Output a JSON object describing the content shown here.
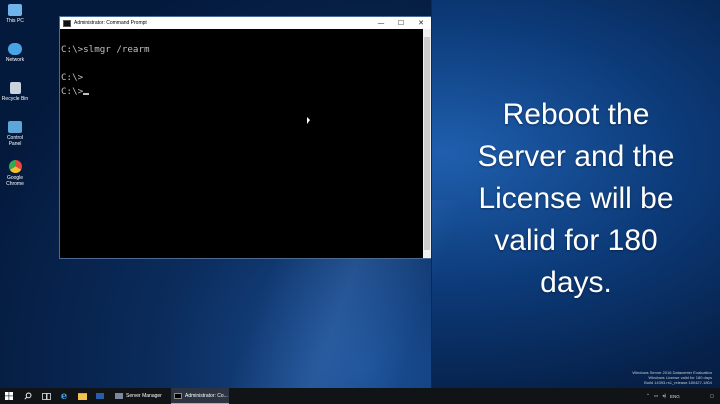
{
  "desktop": {
    "icons": [
      {
        "label": "This PC",
        "icon": "computer-icon",
        "color": "#6fb3ea"
      },
      {
        "label": "Network",
        "icon": "network-icon",
        "color": "#4aa3e6"
      },
      {
        "label": "Recycle Bin",
        "icon": "recycle-bin-icon",
        "color": "#c9d3dc"
      },
      {
        "label": "Control Panel",
        "icon": "control-panel-icon",
        "color": "#5fa6d8"
      },
      {
        "label": "Google Chrome",
        "icon": "chrome-icon",
        "color": "#e8453c"
      }
    ]
  },
  "cmd": {
    "title": "Administrator: Command Prompt",
    "minimize": "—",
    "maximize": "☐",
    "close": "✕",
    "lines": [
      "C:\\>slmgr /rearm",
      "",
      "C:\\>",
      "C:\\>"
    ]
  },
  "overlay": {
    "lines": [
      "Reboot the",
      "Server and the",
      "License will be",
      "valid for 180",
      "days."
    ]
  },
  "watermark": {
    "lines": [
      "Windows Server 2016 Datacenter Evaluation",
      "Windows License valid for 180 days",
      "Build 14393.rs1_release.180427-1804"
    ]
  },
  "taskbar": {
    "start_icon": "windows-icon",
    "apps": [
      {
        "label": "Server Manager",
        "icon": "server-manager-icon"
      },
      {
        "label": "Administrator: Co...",
        "icon": "cmd-icon"
      }
    ],
    "tray": {
      "language": "ENG"
    }
  },
  "colors": {
    "accent": "#76b9ed",
    "taskbar": "#101417",
    "cmd_text": "#c0c0c0"
  }
}
